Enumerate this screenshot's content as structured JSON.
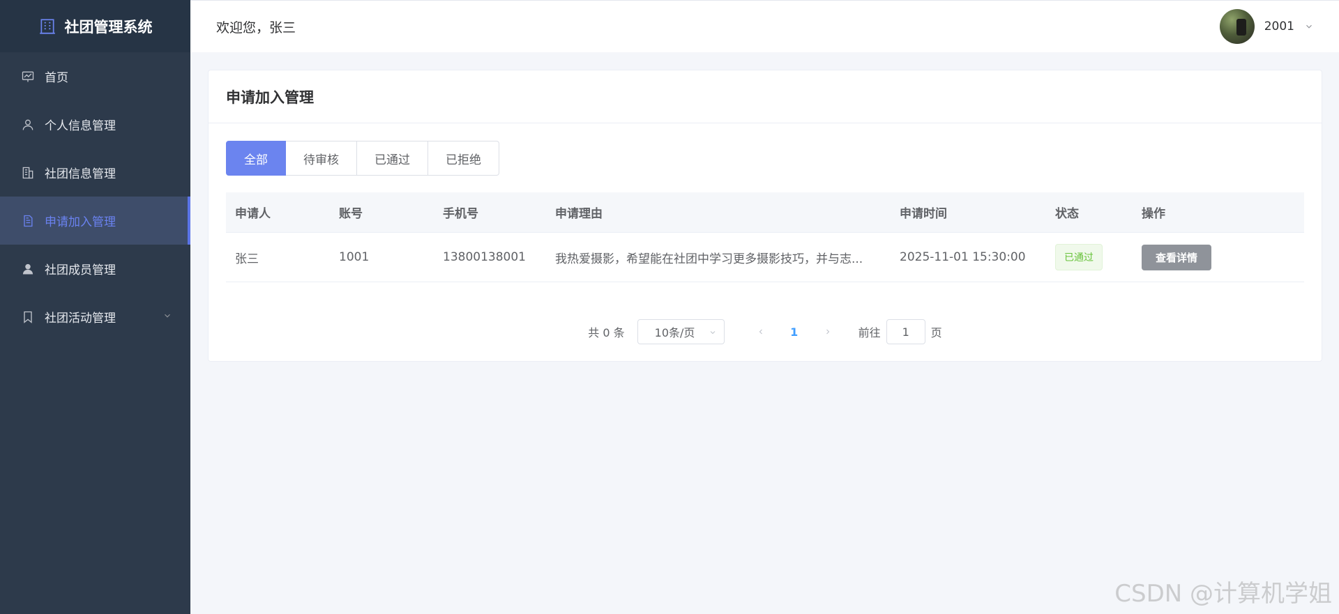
{
  "app": {
    "title": "社团管理系统",
    "logo_icon": "building-icon"
  },
  "sidebar": {
    "items": [
      {
        "label": "首页",
        "icon": "dashboard-icon"
      },
      {
        "label": "个人信息管理",
        "icon": "user-icon"
      },
      {
        "label": "社团信息管理",
        "icon": "office-icon"
      },
      {
        "label": "申请加入管理",
        "icon": "document-icon",
        "active": true
      },
      {
        "label": "社团成员管理",
        "icon": "person-icon"
      },
      {
        "label": "社团活动管理",
        "icon": "bookmark-icon",
        "expandable": true
      }
    ]
  },
  "header": {
    "welcome": "欢迎您，张三",
    "username": "2001"
  },
  "page": {
    "title": "申请加入管理",
    "tabs": [
      {
        "label": "全部",
        "active": true
      },
      {
        "label": "待审核"
      },
      {
        "label": "已通过"
      },
      {
        "label": "已拒绝"
      }
    ]
  },
  "table": {
    "columns": [
      "申请人",
      "账号",
      "手机号",
      "申请理由",
      "申请时间",
      "状态",
      "操作"
    ],
    "rows": [
      {
        "applicant": "张三",
        "account": "1001",
        "phone": "13800138001",
        "reason": "我热爱摄影，希望能在社团中学习更多摄影技巧，并与志...",
        "time": "2025-11-01 15:30:00",
        "status": "已通过",
        "action": "查看详情"
      }
    ]
  },
  "pagination": {
    "total": "共 0 条",
    "page_size": "10条/页",
    "current_page": "1",
    "goto_prefix": "前往",
    "goto_value": "1",
    "goto_suffix": "页"
  },
  "watermark": "CSDN @计算机学姐",
  "colors": {
    "sidebar_bg": "#2d3a4b",
    "accent": "#6b84ef",
    "success": "#67c23a"
  }
}
